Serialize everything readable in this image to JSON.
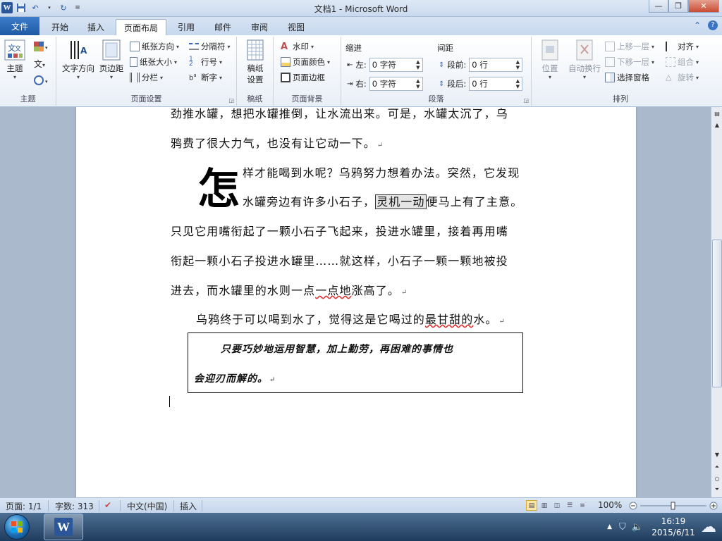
{
  "window": {
    "title": "文档1 - Microsoft Word",
    "app_icon": "W"
  },
  "tabs": {
    "file": "文件",
    "items": [
      "开始",
      "插入",
      "页面布局",
      "引用",
      "邮件",
      "审阅",
      "视图"
    ],
    "active": "页面布局"
  },
  "ribbon": {
    "theme_group": {
      "label": "主题",
      "button": "主题"
    },
    "page_setup": {
      "label": "页面设置",
      "text_direction": "文字方向",
      "margins": "页边距",
      "orientation": "纸张方向",
      "size": "纸张大小",
      "columns": "分栏",
      "breaks": "分隔符",
      "line_numbers": "行号",
      "hyphenation": "断字"
    },
    "paper_group": {
      "label": "稿纸",
      "button_line1": "稿纸",
      "button_line2": "设置"
    },
    "page_background": {
      "label": "页面背景",
      "watermark": "水印",
      "page_color": "页面颜色",
      "page_borders": "页面边框"
    },
    "paragraph": {
      "label": "段落",
      "indent_title": "缩进",
      "spacing_title": "间距",
      "left_label": "左:",
      "left_value": "0 字符",
      "right_label": "右:",
      "right_value": "0 字符",
      "before_label": "段前:",
      "before_value": "0 行",
      "after_label": "段后:",
      "after_value": "0 行"
    },
    "arrange": {
      "label": "排列",
      "position": "位置",
      "wrap_text": "自动换行",
      "bring_forward": "上移一层",
      "send_backward": "下移一层",
      "selection_pane": "选择窗格",
      "align": "对齐",
      "group": "组合",
      "rotate": "旋转"
    }
  },
  "document": {
    "line1": "劲推水罐，想把水罐推倒，让水流出来。可是，水罐太沉了，乌",
    "line2": "鸦费了很大力气，也没有让它动一下。",
    "dropcap": "怎",
    "line3": "样才能喝到水呢？乌鸦努力想着办法。突然，它发现",
    "line4_pre": "水罐旁边有许多小石子，",
    "line4_highlight": "灵机一动",
    "line4_post": "便马上有了主意。",
    "line5": "只见它用嘴衔起了一颗小石子飞起来，投进水罐里，接着再用嘴",
    "line6": "衔起一颗小石子投进水罐里……就这样，小石子一颗一颗地被投",
    "line7_pre": "进去，而水罐里的水则一点",
    "line7_wavy": "一点地",
    "line7_post": "涨高了。",
    "line8_pre": "乌鸦终于可以喝到水了，觉得这是它喝过的",
    "line8_wavy": "最甘甜的",
    "line8_post": "水。",
    "box_line1": "只要巧妙地运用智慧，加上勤劳，再困难的事情也",
    "box_line2": "会迎刃而解的。",
    "para_mark": "↵"
  },
  "statusbar": {
    "page": "页面: 1/1",
    "words": "字数: 313",
    "language": "中文(中国)",
    "mode": "插入",
    "zoom": "100%"
  },
  "taskbar": {
    "time": "16:19",
    "date": "2015/6/11"
  }
}
